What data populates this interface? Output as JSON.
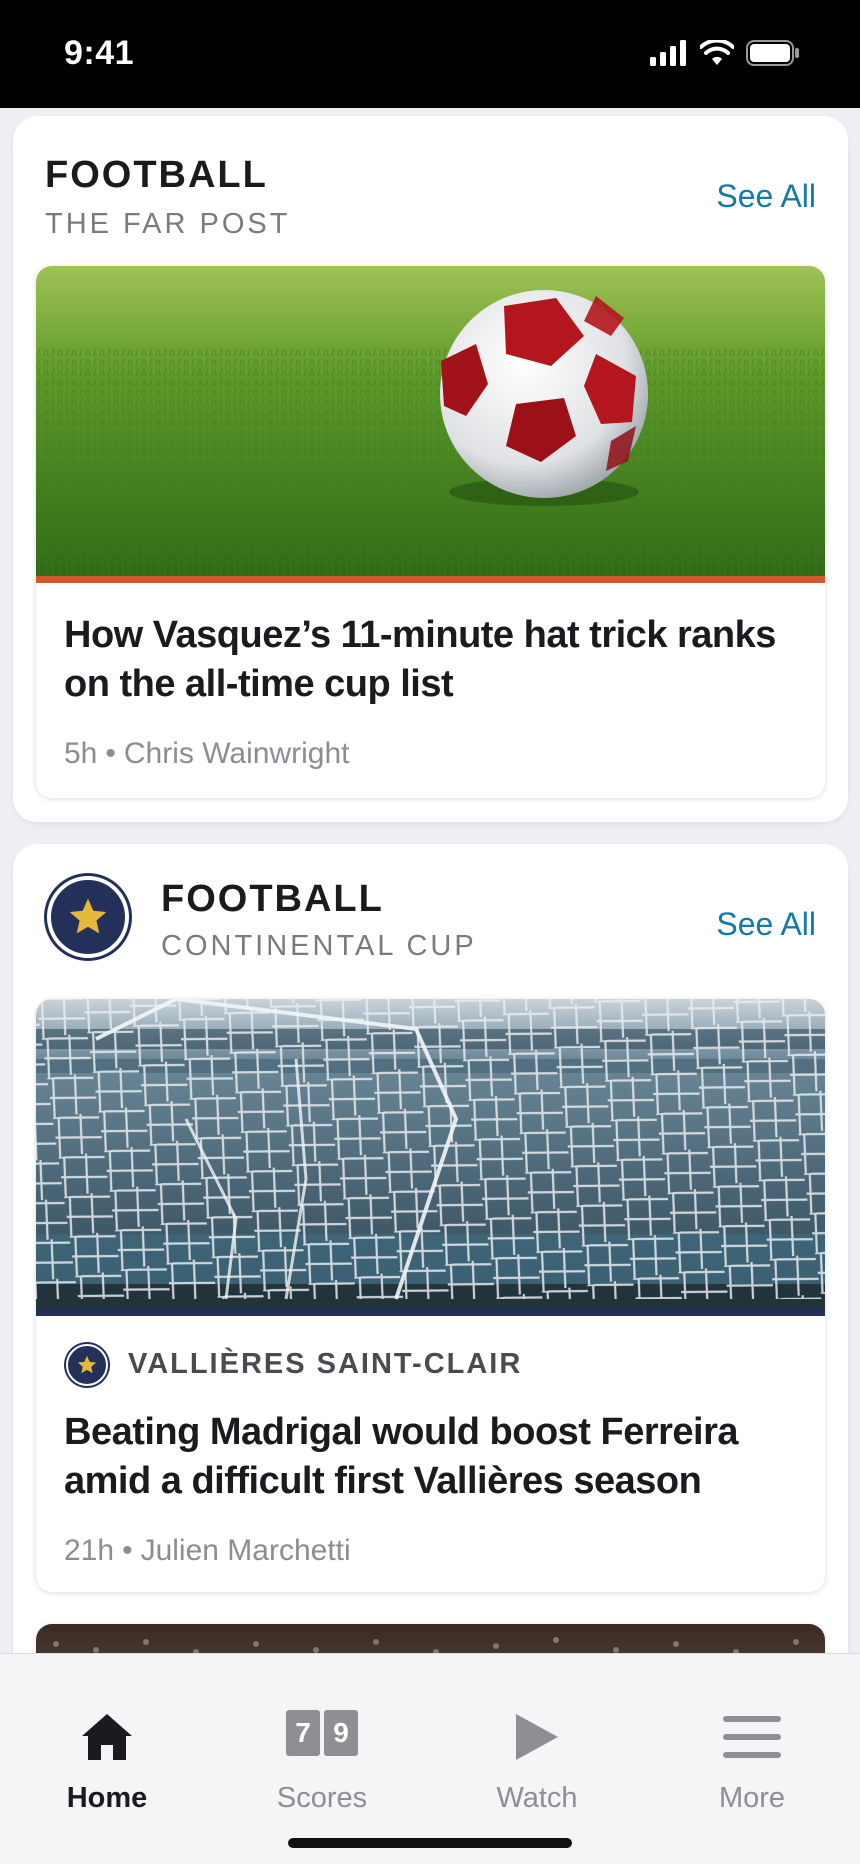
{
  "status_bar": {
    "time": "9:41"
  },
  "sections": [
    {
      "title": "FOOTBALL",
      "subtitle": "THE FAR POST",
      "see_all": "See All",
      "article": {
        "headline": "How Vasquez’s 11-minute hat trick ranks on the all-time cup list",
        "age": "5h",
        "author": "Chris Wainwright",
        "stripe_color": "#d2572c"
      }
    },
    {
      "title": "FOOTBALL",
      "subtitle": "CONTINENTAL CUP",
      "see_all": "See All",
      "article": {
        "team": "VALLIÈRES SAINT-CLAIR",
        "headline": "Beating Madrigal would boost Ferreira amid a difficult first Vallières season",
        "age": "21h",
        "author": "Julien Marchetti",
        "stripe_color": "#23305a"
      }
    }
  ],
  "tab_bar": {
    "tabs": [
      {
        "label": "Home",
        "icon": "home-icon",
        "active": true
      },
      {
        "label": "Scores",
        "icon": "scores-icon",
        "score_left": "7",
        "score_right": "9"
      },
      {
        "label": "Watch",
        "icon": "play-icon"
      },
      {
        "label": "More",
        "icon": "hamburger-icon"
      }
    ]
  },
  "colors": {
    "accent": "#1479a6",
    "team_navy": "#23305a",
    "team_gold": "#e6b83a"
  }
}
